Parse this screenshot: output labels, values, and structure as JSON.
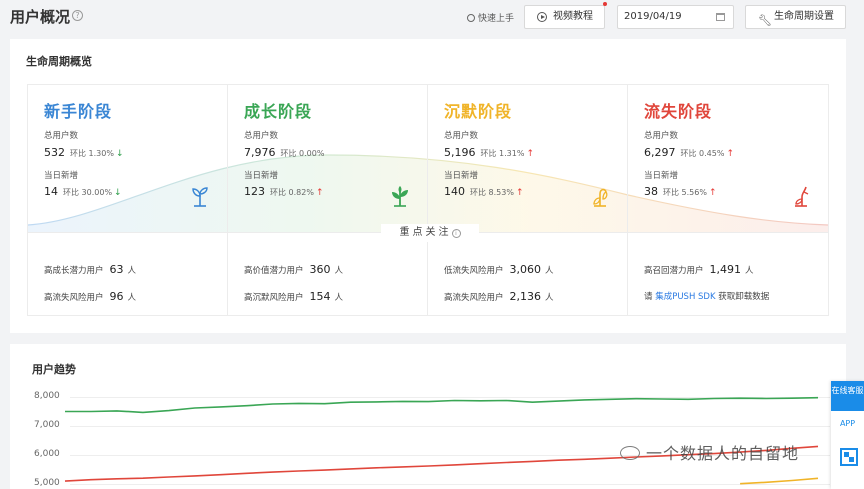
{
  "header": {
    "title": "用户概况",
    "help_icon": "question-circle-icon",
    "quick_start": "快速上手",
    "video_tutorial": "视频教程",
    "date": "2019/04/19",
    "lifecycle_settings": "生命周期设置"
  },
  "overview": {
    "title": "生命周期概览",
    "stages": [
      {
        "name": "新手阶段",
        "color": "#3a86d4",
        "total_label": "总用户数",
        "total": "532",
        "total_ratio": "环比 1.30%",
        "total_trend": "down",
        "new_label": "当日新增",
        "new": "14",
        "new_ratio": "环比 30.00%",
        "new_trend": "down",
        "icon": "sprout-icon"
      },
      {
        "name": "成长阶段",
        "color": "#3aa655",
        "total_label": "总用户数",
        "total": "7,976",
        "total_ratio": "环比 0.00%",
        "total_trend": "none",
        "new_label": "当日新增",
        "new": "123",
        "new_ratio": "环比 0.82%",
        "new_trend": "up",
        "icon": "plant-icon"
      },
      {
        "name": "沉默阶段",
        "color": "#f0b429",
        "total_label": "总用户数",
        "total": "5,196",
        "total_ratio": "环比 1.31%",
        "total_trend": "up",
        "new_label": "当日新增",
        "new": "140",
        "new_ratio": "环比 8.53%",
        "new_trend": "up",
        "icon": "wilting-plant-icon"
      },
      {
        "name": "流失阶段",
        "color": "#e0463b",
        "total_label": "总用户数",
        "total": "6,297",
        "total_ratio": "环比 0.45%",
        "total_trend": "up",
        "new_label": "当日新增",
        "new": "38",
        "new_ratio": "环比 5.56%",
        "new_trend": "up",
        "icon": "dead-plant-icon"
      }
    ],
    "focus": {
      "title": "重点关注",
      "cells": [
        {
          "bg": "#f3f8fd",
          "rows": [
            {
              "label": "高成长潜力用户",
              "value": "63",
              "unit": "人"
            },
            {
              "label": "高流失风险用户",
              "value": "96",
              "unit": "人"
            }
          ]
        },
        {
          "bg": "#f3faf4",
          "rows": [
            {
              "label": "高价值潜力用户",
              "value": "360",
              "unit": "人"
            },
            {
              "label": "高沉默风险用户",
              "value": "154",
              "unit": "人"
            }
          ]
        },
        {
          "bg": "#fefbf1",
          "rows": [
            {
              "label": "低流失风险用户",
              "value": "3,060",
              "unit": "人"
            },
            {
              "label": "高流失风险用户",
              "value": "2,136",
              "unit": "人"
            }
          ]
        },
        {
          "bg": "#fdf4f3",
          "rows": [
            {
              "label": "高召回潜力用户",
              "value": "1,491",
              "unit": "人"
            },
            {
              "prefix": "请 ",
              "link": "集成PUSH SDK",
              "suffix": " 获取卸载数据"
            }
          ]
        }
      ]
    }
  },
  "trend": {
    "title": "用户趋势",
    "yticks": [
      "8,000",
      "7,000",
      "6,000",
      "5,000"
    ]
  },
  "chart_data": {
    "type": "line",
    "title": "用户趋势",
    "ylim": [
      4900,
      8300
    ],
    "x": [
      0,
      1,
      2,
      3,
      4,
      5,
      6,
      7,
      8,
      9,
      10,
      11,
      12,
      13,
      14,
      15,
      16,
      17,
      18,
      19,
      20,
      21,
      22,
      23,
      24,
      25,
      26,
      27,
      28,
      29
    ],
    "series": [
      {
        "color": "#3aa655",
        "values": [
          7500,
          7500,
          7520,
          7470,
          7530,
          7620,
          7660,
          7700,
          7760,
          7780,
          7770,
          7820,
          7830,
          7850,
          7840,
          7880,
          7870,
          7880,
          7820,
          7860,
          7900,
          7920,
          7940,
          7930,
          7920,
          7950,
          7960,
          7950,
          7960,
          7976
        ]
      },
      {
        "color": "#e0463b",
        "values": [
          5100,
          5150,
          5180,
          5200,
          5240,
          5280,
          5320,
          5370,
          5410,
          5450,
          5480,
          5520,
          5560,
          5590,
          5620,
          5660,
          5700,
          5740,
          5780,
          5820,
          5850,
          5890,
          5930,
          5970,
          6010,
          6050,
          6100,
          6160,
          6230,
          6297
        ]
      },
      {
        "color": "#f0b429",
        "values": [
          null,
          null,
          null,
          null,
          null,
          null,
          null,
          null,
          null,
          null,
          null,
          null,
          null,
          null,
          null,
          null,
          null,
          null,
          null,
          null,
          null,
          null,
          null,
          null,
          null,
          null,
          5010,
          5060,
          5120,
          5196
        ]
      }
    ]
  },
  "side_tools": {
    "online_service": "在线客服",
    "app": "APP",
    "qr": "qr-code-icon"
  },
  "watermark": "一个数据人的自留地"
}
